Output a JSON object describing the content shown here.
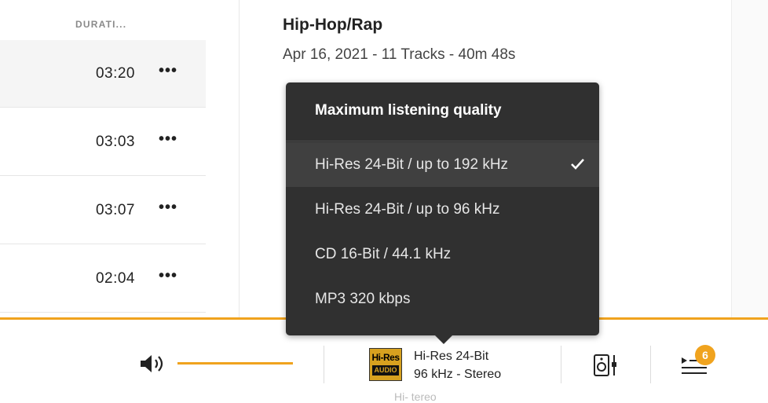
{
  "tracklist": {
    "column_header": "DURATI...",
    "rows": [
      {
        "duration": "03:20",
        "more": "•••"
      },
      {
        "duration": "03:03",
        "more": "•••"
      },
      {
        "duration": "03:07",
        "more": "•••"
      },
      {
        "duration": "02:04",
        "more": "•••"
      }
    ]
  },
  "album": {
    "genre": "Hip-Hop/Rap",
    "meta": "Apr 16, 2021 - 11 Tracks - 40m 48s"
  },
  "quality_menu": {
    "title": "Maximum listening quality",
    "options": [
      {
        "label": "Hi-Res 24-Bit / up to 192 kHz",
        "selected": true
      },
      {
        "label": "Hi-Res 24-Bit / up to 96 kHz",
        "selected": false
      },
      {
        "label": "CD 16-Bit / 44.1 kHz",
        "selected": false
      },
      {
        "label": "MP3 320 kbps",
        "selected": false
      }
    ]
  },
  "player": {
    "hires_logo_top": "Hi-Res",
    "hires_logo_bottom": "AUDIO",
    "quality_line1": "Hi-Res 24-Bit",
    "quality_line2": "96 kHz - Stereo",
    "tooltip_ghost": "Hi-    tereo",
    "queue_count": "6"
  },
  "colors": {
    "accent": "#f0a31e",
    "popup_bg": "#303030",
    "popup_selected_bg": "#404040"
  },
  "icons": [
    "more-dots-icon",
    "volume-icon",
    "check-icon",
    "speaker-icon",
    "queue-icon"
  ]
}
